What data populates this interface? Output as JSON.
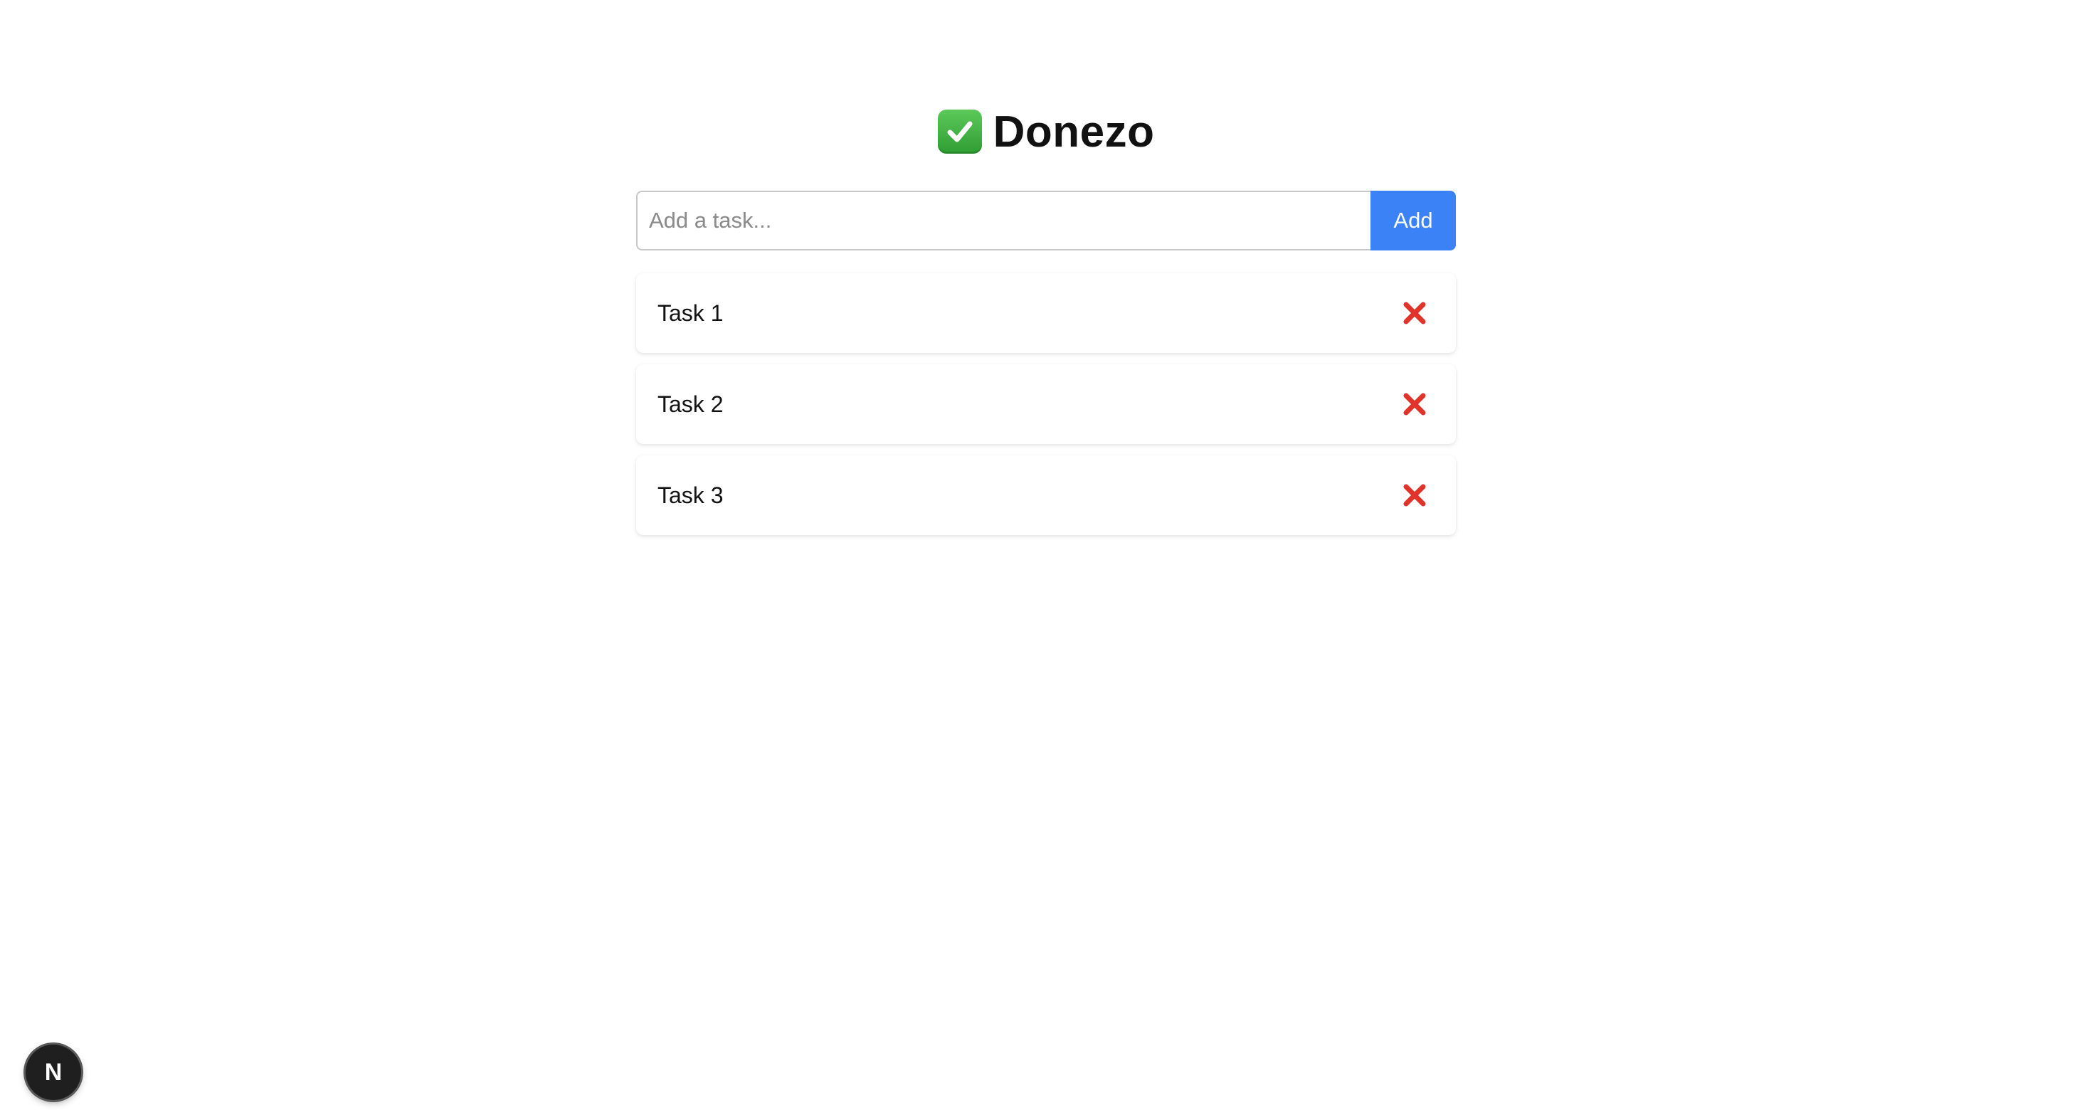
{
  "header": {
    "title": "Donezo",
    "icon": "white-check-mark-icon"
  },
  "form": {
    "placeholder": "Add a task...",
    "value": "",
    "add_label": "Add"
  },
  "tasks": [
    {
      "label": "Task 1"
    },
    {
      "label": "Task 2"
    },
    {
      "label": "Task 3"
    }
  ],
  "dev_badge": {
    "letter": "N",
    "icon": "nextjs-dev-indicator-icon"
  },
  "colors": {
    "accent": "#3b82f6",
    "delete": "#e0342b",
    "check_bg": "#3aa93c",
    "badge_bg": "#1f1f1f"
  }
}
